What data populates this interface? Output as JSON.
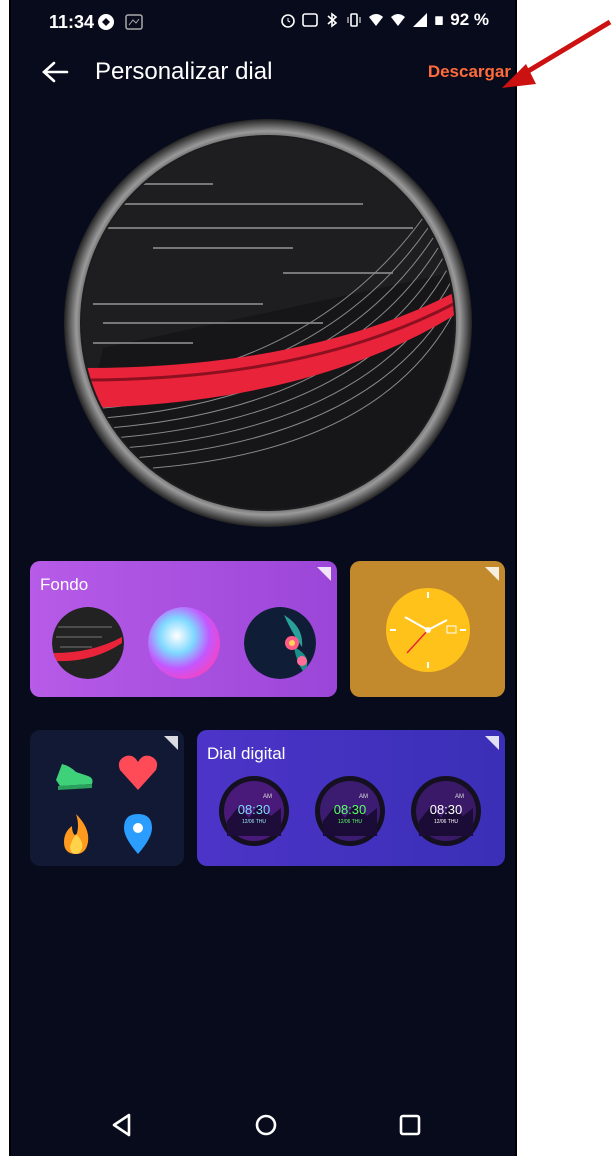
{
  "status_bar": {
    "time": "11:34",
    "battery": "92 %",
    "icons": [
      "s-logo-icon",
      "cat-notification-icon",
      "alarm-icon",
      "nfc-icon",
      "bluetooth-icon",
      "vibrate-icon",
      "wifi-icon",
      "wifi-icon",
      "signal-icon",
      "battery-icon"
    ]
  },
  "app_bar": {
    "title": "Personalizar dial",
    "action": "Descargar",
    "back_icon": "arrow-left-icon"
  },
  "cards": {
    "background": {
      "title": "Fondo",
      "thumbnails": [
        "stripes-thumbnail",
        "gradient-thumbnail",
        "floral-thumbnail"
      ]
    },
    "pointer": {
      "thumbnail": "analog-clock-thumbnail"
    },
    "widgets": {
      "icons": [
        "steps-shoe-icon",
        "heart-icon",
        "flame-icon",
        "location-pin-icon"
      ]
    },
    "digital": {
      "title": "Dial digital",
      "faces": [
        {
          "time": "08:30",
          "ampm": "AM",
          "date": "12/06 THU"
        },
        {
          "time": "08:30",
          "ampm": "AM",
          "date": "12/06 THU"
        },
        {
          "time": "08:30",
          "ampm": "AM",
          "date": "12/06 THU"
        }
      ]
    }
  },
  "nav_bar": {
    "icons": [
      "back-triangle-icon",
      "home-circle-icon",
      "recents-square-icon"
    ]
  },
  "colors": {
    "accent": "#ff6a3a",
    "background": "#070b1c",
    "fondo_card": "#b75be8",
    "pointer_card": "#c28a2c",
    "digital_card": "#4c34c8",
    "annotation_arrow": "#cc1111"
  }
}
